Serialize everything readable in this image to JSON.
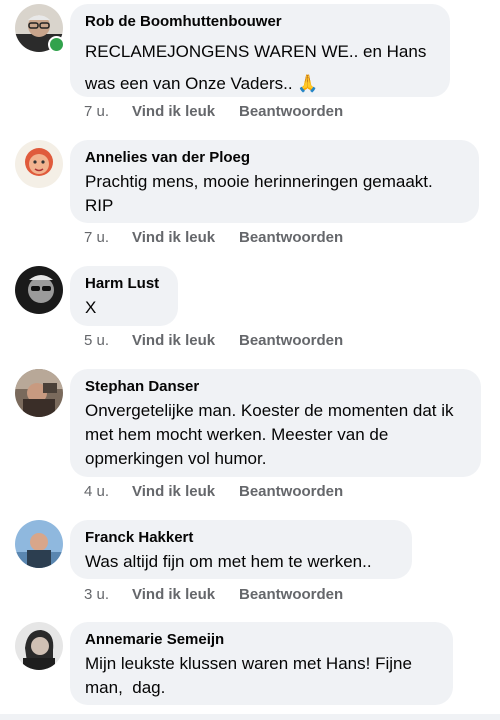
{
  "comments": [
    {
      "author": "Rob de Boomhuttenbouwer",
      "text": "RECLAMEJONGENS WAREN WE.. en Hans was een van Onze Vaders.. 🙏",
      "time": "7 u.",
      "online": true
    },
    {
      "author": "Annelies van der Ploeg",
      "text": "Prachtig mens, mooie herinneringen gemaakt. RIP",
      "time": "7 u."
    },
    {
      "author": "Harm Lust",
      "text": "X",
      "time": "5 u."
    },
    {
      "author": "Stephan Danser",
      "text": "Onvergetelijke man. Koester de momenten dat ik met hem mocht werken. Meester van de opmerkingen vol humor.",
      "time": "4 u."
    },
    {
      "author": "Franck Hakkert",
      "text": "Was altijd fijn om met hem te werken..",
      "time": "3 u."
    },
    {
      "author": "Annemarie Semeijn",
      "text": "Mijn leukste klussen waren met Hans! Fijne man,  dag."
    }
  ],
  "actions": {
    "like_label": "Vind ik leuk",
    "reply_label": "Beantwoorden"
  },
  "colors": {
    "bubble": "#f0f2f5",
    "meta_text": "#65676b",
    "online": "#31a24c"
  }
}
